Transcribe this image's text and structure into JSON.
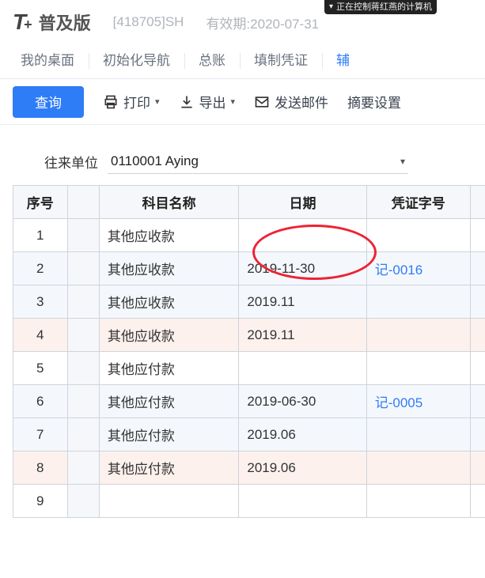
{
  "remote_bar": {
    "text": "正在控制蒋红燕的计算机"
  },
  "brand": {
    "t": "T",
    "plus": "+",
    "edition": "普及版"
  },
  "header": {
    "org": "[418705]SH",
    "expiry": "有效期:2020-07-31"
  },
  "nav": {
    "tabs": [
      {
        "label": "我的桌面",
        "active": false
      },
      {
        "label": "初始化导航",
        "active": false
      },
      {
        "label": "总账",
        "active": false
      },
      {
        "label": "填制凭证",
        "active": false
      },
      {
        "label": "辅",
        "active": true
      }
    ]
  },
  "toolbar": {
    "query": "查询",
    "print": "打印",
    "export": "导出",
    "mail": "发送邮件",
    "summary": "摘要设置"
  },
  "filter": {
    "label": "往来单位",
    "value": "0110001 Aying"
  },
  "table": {
    "headers": {
      "seq": "序号",
      "subject": "科目名称",
      "date": "日期",
      "vno": "凭证字号"
    },
    "rows": [
      {
        "seq": "1",
        "subject": "其他应收款",
        "date": "",
        "vno": "",
        "cls": ""
      },
      {
        "seq": "2",
        "subject": "其他应收款",
        "date": "2019-11-30",
        "vno": "记-0016",
        "cls": "alt"
      },
      {
        "seq": "3",
        "subject": "其他应收款",
        "date": "2019.11",
        "vno": "",
        "cls": "alt"
      },
      {
        "seq": "4",
        "subject": "其他应收款",
        "date": "2019.11",
        "vno": "",
        "cls": "alt2"
      },
      {
        "seq": "5",
        "subject": "其他应付款",
        "date": "",
        "vno": "",
        "cls": ""
      },
      {
        "seq": "6",
        "subject": "其他应付款",
        "date": "2019-06-30",
        "vno": "记-0005",
        "cls": "alt"
      },
      {
        "seq": "7",
        "subject": "其他应付款",
        "date": "2019.06",
        "vno": "",
        "cls": "alt"
      },
      {
        "seq": "8",
        "subject": "其他应付款",
        "date": "2019.06",
        "vno": "",
        "cls": "alt2"
      },
      {
        "seq": "9",
        "subject": "",
        "date": "",
        "vno": "",
        "cls": ""
      }
    ]
  },
  "annotation": {
    "ellipse_on_column": "date"
  }
}
